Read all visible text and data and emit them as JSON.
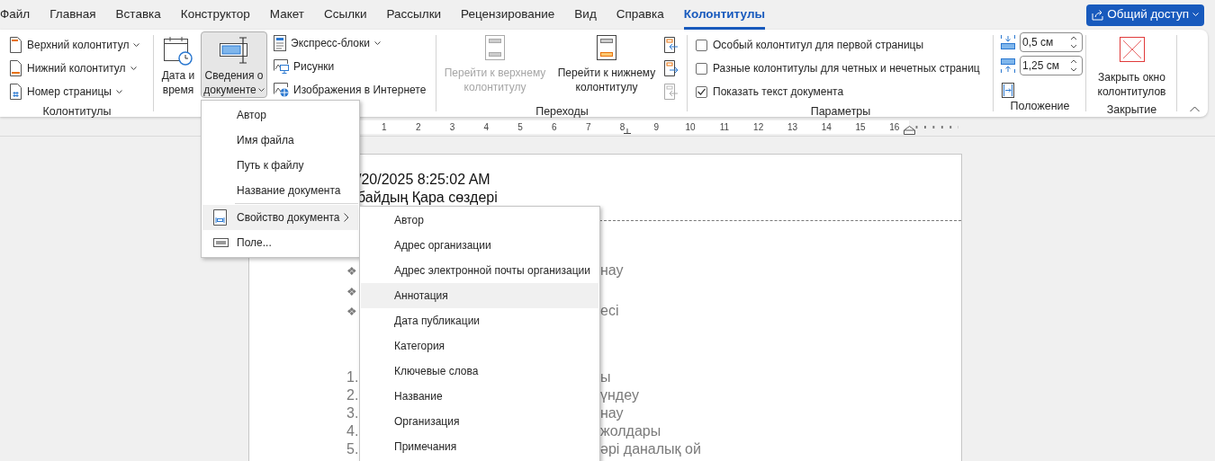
{
  "tabs": [
    {
      "label": "Файл",
      "selected": false
    },
    {
      "label": "Главная",
      "selected": false
    },
    {
      "label": "Вставка",
      "selected": false
    },
    {
      "label": "Конструктор",
      "selected": false
    },
    {
      "label": "Макет",
      "selected": false
    },
    {
      "label": "Ссылки",
      "selected": false
    },
    {
      "label": "Рассылки",
      "selected": false
    },
    {
      "label": "Рецензирование",
      "selected": false
    },
    {
      "label": "Вид",
      "selected": false
    },
    {
      "label": "Справка",
      "selected": false
    },
    {
      "label": "Колонтитулы",
      "selected": true
    }
  ],
  "share_button": {
    "label": "Общий доступ"
  },
  "header_footer_group": {
    "label": "Колонтитулы",
    "items": [
      {
        "label": "Верхний колонтитул",
        "dropdown": true
      },
      {
        "label": "Нижний колонтитул",
        "dropdown": true
      },
      {
        "label": "Номер страницы",
        "dropdown": true
      }
    ]
  },
  "insert_group": {
    "large_buttons": [
      {
        "label": "Дата и время",
        "dropdown": false,
        "pressed": false
      },
      {
        "label": "Сведения о документе",
        "dropdown": true,
        "pressed": true
      }
    ],
    "small_buttons": [
      {
        "label": "Экспресс-блоки",
        "dropdown": true
      },
      {
        "label": "Рисунки",
        "dropdown": false
      },
      {
        "label": "Изображения в Интернете",
        "dropdown": false
      }
    ]
  },
  "navigation_group": {
    "label": "Переходы",
    "large_buttons": [
      {
        "label": "Перейти к верхнему колонтитулу",
        "disabled": true
      },
      {
        "label": "Перейти к нижнему колонтитулу",
        "disabled": false
      }
    ],
    "small_buttons": [
      {
        "disabled": false
      },
      {
        "disabled": false
      },
      {
        "disabled": true
      }
    ]
  },
  "options_group": {
    "label": "Параметры",
    "checkboxes": [
      {
        "label": "Особый колонтитул для первой страницы",
        "checked": false
      },
      {
        "label": "Разные колонтитулы для четных и нечетных страниц",
        "checked": false
      },
      {
        "label": "Показать текст документа",
        "checked": true
      }
    ]
  },
  "position_group": {
    "label": "Положение",
    "spinners": [
      {
        "value": "0,5 см"
      },
      {
        "value": "1,25 см"
      }
    ]
  },
  "close_group": {
    "label": "Закрытие",
    "button": {
      "label": "Закрыть окно колонтитулов"
    }
  },
  "ruler": {
    "labels": [
      "1",
      "2",
      "3",
      "4",
      "5",
      "6",
      "7",
      "8",
      "9",
      "10",
      "11",
      "12",
      "13",
      "14",
      "15",
      "16"
    ]
  },
  "document": {
    "header_lines": [
      "/20/2025 8:25:02 AM",
      "байдың Қара сөздері"
    ],
    "bullets": [
      {
        "marker": "❖",
        "text": "нау"
      },
      {
        "marker": "❖"
      },
      {
        "marker": "❖",
        "text": "есі"
      }
    ],
    "numbered": [
      {
        "marker": "1.",
        "text": "ы"
      },
      {
        "marker": "2.",
        "text": "үндеу"
      },
      {
        "marker": "3.",
        "text": "нау"
      },
      {
        "marker": "4.",
        "text": "жолдары"
      },
      {
        "marker": "5.",
        "text": "әрі даналық ой"
      }
    ]
  },
  "dropdown_menu": {
    "items": [
      {
        "kind": "plain",
        "label": "Автор",
        "selected": false
      },
      {
        "kind": "plain",
        "label": "Имя файла",
        "selected": false
      },
      {
        "kind": "plain",
        "label": "Путь к файлу",
        "selected": false
      },
      {
        "kind": "plain",
        "label": "Название документа",
        "selected": false
      },
      {
        "kind": "separator"
      },
      {
        "kind": "property",
        "label": "Свойство документа",
        "selected": true
      },
      {
        "kind": "field",
        "label": "Поле...",
        "selected": false
      }
    ]
  },
  "submenu": {
    "items": [
      {
        "label": "Автор",
        "selected": false
      },
      {
        "label": "Адрес организации",
        "selected": false
      },
      {
        "label": "Адрес электронной почты организации",
        "selected": false
      },
      {
        "label": "Аннотация",
        "selected": true
      },
      {
        "label": "Дата публикации",
        "selected": false
      },
      {
        "label": "Категория",
        "selected": false
      },
      {
        "label": "Ключевые слова",
        "selected": false
      },
      {
        "label": "Название",
        "selected": false
      },
      {
        "label": "Организация",
        "selected": false
      },
      {
        "label": "Примечания",
        "selected": false
      }
    ]
  }
}
